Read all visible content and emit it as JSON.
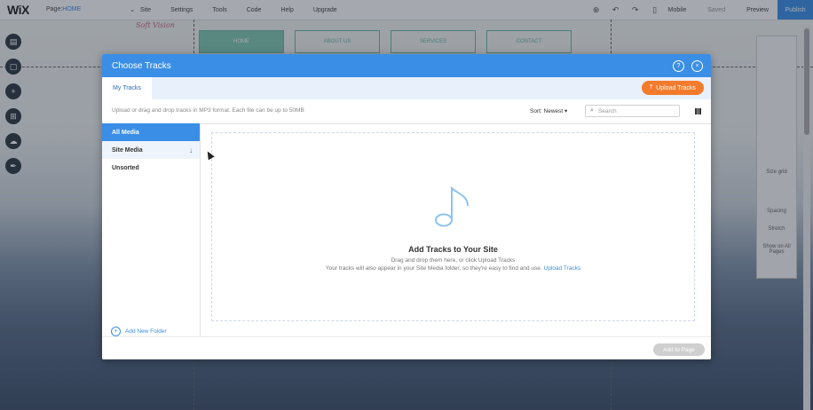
{
  "editor": {
    "logo": "WiX",
    "page_selector": {
      "label": "Page:",
      "value": "HOME",
      "caret": "⌄"
    },
    "menu": [
      "Site",
      "Settings",
      "Tools",
      "Code",
      "Help",
      "Upgrade"
    ],
    "right": {
      "mobile_label": "Mobile",
      "save_label": "Saved",
      "preview_label": "Preview",
      "publish_label": "Publish"
    }
  },
  "site": {
    "logo_text": "Soft Vision",
    "nav": [
      "HOME",
      "ABOUT US",
      "SERVICES",
      "CONTACT"
    ]
  },
  "right_panel": [
    "Size grid",
    "Spacing",
    "Stretch",
    "Show on All Pages"
  ],
  "modal": {
    "title": "Choose Tracks",
    "tab_label": "My Tracks",
    "upload_label": "Upload Tracks",
    "hint": "Upload or drag and drop tracks in MP3 format. Each file can be up to 50MB",
    "sort_label": "Sort: Newest",
    "sort_caret": "▾",
    "search_placeholder": "Search",
    "folders": [
      {
        "label": "All Media"
      },
      {
        "label": "Site Media",
        "arrow": "↓"
      },
      {
        "label": "Unsorted"
      }
    ],
    "add_folder_label": "Add New Folder",
    "drop_title": "Add Tracks to Your Site",
    "drop_line1": "Drag and drop them here, or click Upload Tracks",
    "drop_line2": "Your tracks will also appear in your Site Media folder, so they're easy to find and use.",
    "drop_link": "Upload Tracks",
    "add_to_page_label": "Add to Page"
  },
  "colors": {
    "accent": "#3a8ee6",
    "upload": "#f57b2c"
  }
}
